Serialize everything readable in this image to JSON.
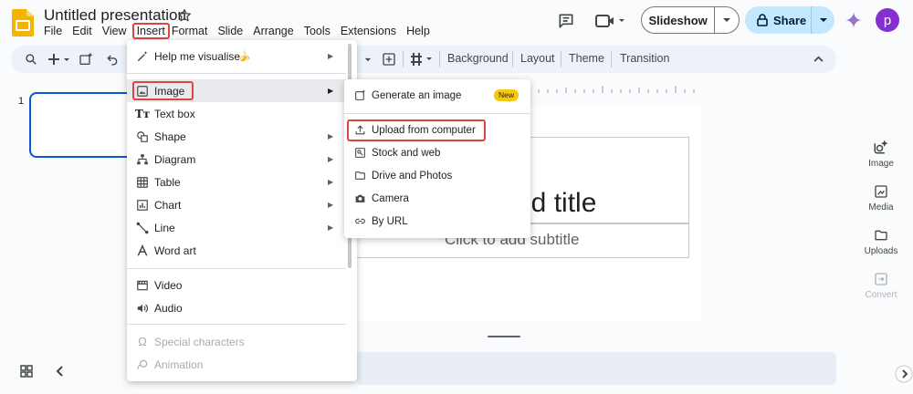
{
  "app": {
    "title": "Untitled presentation",
    "brand_color": "#f4b400",
    "menu": [
      "File",
      "Edit",
      "View",
      "Insert",
      "Format",
      "Slide",
      "Arrange",
      "Tools",
      "Extensions",
      "Help"
    ],
    "active_menu": "Insert"
  },
  "header": {
    "slideshow_label": "Slideshow",
    "share_label": "Share",
    "avatar_initial": "p"
  },
  "toolbar": {
    "items": [
      "Background",
      "Layout",
      "Theme",
      "Transition"
    ]
  },
  "filmstrip": {
    "slide_number": "1"
  },
  "slide": {
    "title_placeholder": "dd title",
    "subtitle_placeholder": "Click to add subtitle"
  },
  "side_panel": {
    "items": [
      {
        "label": "Image",
        "icon": "image-sparkle-icon"
      },
      {
        "label": "Media",
        "icon": "media-icon"
      },
      {
        "label": "Uploads",
        "icon": "folder-icon"
      },
      {
        "label": "Convert",
        "icon": "convert-icon",
        "disabled": true
      }
    ]
  },
  "insert_menu": {
    "items": [
      {
        "label": "Help me visualise",
        "icon": "magic-pen-icon",
        "submenu": true
      },
      {
        "label": "Image",
        "icon": "image-icon",
        "submenu": true,
        "highlighted": true
      },
      {
        "label": "Text box",
        "icon": "text-box-icon"
      },
      {
        "label": "Shape",
        "icon": "shape-icon",
        "submenu": true
      },
      {
        "label": "Diagram",
        "icon": "diagram-icon",
        "submenu": true
      },
      {
        "label": "Table",
        "icon": "table-icon",
        "submenu": true
      },
      {
        "label": "Chart",
        "icon": "chart-icon",
        "submenu": true
      },
      {
        "label": "Line",
        "icon": "line-icon",
        "submenu": true
      },
      {
        "label": "Word art",
        "icon": "word-art-icon"
      },
      {
        "label": "Video",
        "icon": "video-icon"
      },
      {
        "label": "Audio",
        "icon": "audio-icon"
      },
      {
        "label": "Special characters",
        "icon": "omega-icon",
        "disabled": true
      },
      {
        "label": "Animation",
        "icon": "animation-icon",
        "disabled": true
      }
    ]
  },
  "image_submenu": {
    "items": [
      {
        "label": "Generate an image",
        "icon": "generate-image-icon",
        "badge": "New"
      },
      {
        "label": "Upload from computer",
        "icon": "upload-icon",
        "highlighted": true
      },
      {
        "label": "Stock and web",
        "icon": "stock-icon"
      },
      {
        "label": "Drive and Photos",
        "icon": "drive-icon"
      },
      {
        "label": "Camera",
        "icon": "camera-icon"
      },
      {
        "label": "By URL",
        "icon": "link-icon"
      }
    ]
  }
}
